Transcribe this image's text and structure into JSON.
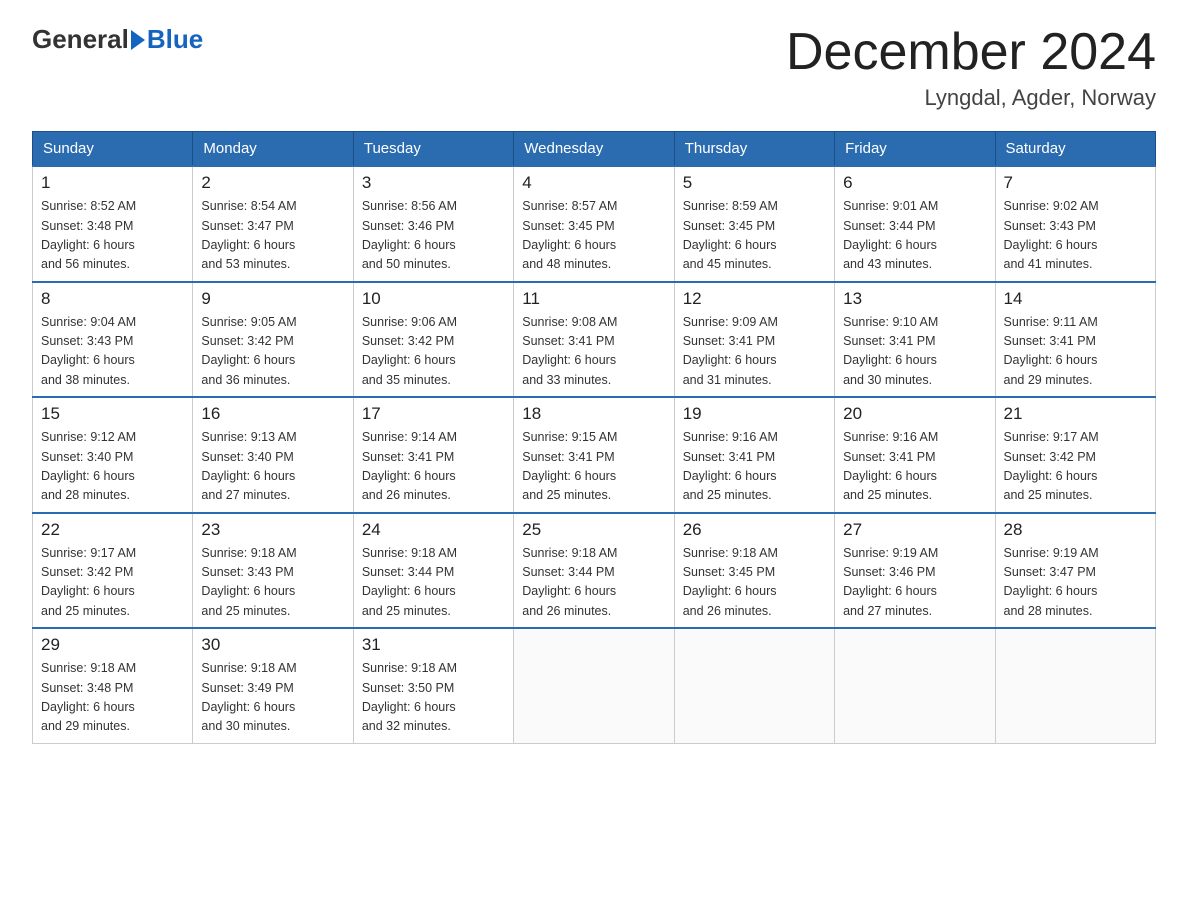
{
  "logo": {
    "general": "General",
    "blue": "Blue"
  },
  "title": "December 2024",
  "subtitle": "Lyngdal, Agder, Norway",
  "days_of_week": [
    "Sunday",
    "Monday",
    "Tuesday",
    "Wednesday",
    "Thursday",
    "Friday",
    "Saturday"
  ],
  "weeks": [
    [
      {
        "day": "1",
        "sunrise": "8:52 AM",
        "sunset": "3:48 PM",
        "daylight": "6 hours and 56 minutes."
      },
      {
        "day": "2",
        "sunrise": "8:54 AM",
        "sunset": "3:47 PM",
        "daylight": "6 hours and 53 minutes."
      },
      {
        "day": "3",
        "sunrise": "8:56 AM",
        "sunset": "3:46 PM",
        "daylight": "6 hours and 50 minutes."
      },
      {
        "day": "4",
        "sunrise": "8:57 AM",
        "sunset": "3:45 PM",
        "daylight": "6 hours and 48 minutes."
      },
      {
        "day": "5",
        "sunrise": "8:59 AM",
        "sunset": "3:45 PM",
        "daylight": "6 hours and 45 minutes."
      },
      {
        "day": "6",
        "sunrise": "9:01 AM",
        "sunset": "3:44 PM",
        "daylight": "6 hours and 43 minutes."
      },
      {
        "day": "7",
        "sunrise": "9:02 AM",
        "sunset": "3:43 PM",
        "daylight": "6 hours and 41 minutes."
      }
    ],
    [
      {
        "day": "8",
        "sunrise": "9:04 AM",
        "sunset": "3:43 PM",
        "daylight": "6 hours and 38 minutes."
      },
      {
        "day": "9",
        "sunrise": "9:05 AM",
        "sunset": "3:42 PM",
        "daylight": "6 hours and 36 minutes."
      },
      {
        "day": "10",
        "sunrise": "9:06 AM",
        "sunset": "3:42 PM",
        "daylight": "6 hours and 35 minutes."
      },
      {
        "day": "11",
        "sunrise": "9:08 AM",
        "sunset": "3:41 PM",
        "daylight": "6 hours and 33 minutes."
      },
      {
        "day": "12",
        "sunrise": "9:09 AM",
        "sunset": "3:41 PM",
        "daylight": "6 hours and 31 minutes."
      },
      {
        "day": "13",
        "sunrise": "9:10 AM",
        "sunset": "3:41 PM",
        "daylight": "6 hours and 30 minutes."
      },
      {
        "day": "14",
        "sunrise": "9:11 AM",
        "sunset": "3:41 PM",
        "daylight": "6 hours and 29 minutes."
      }
    ],
    [
      {
        "day": "15",
        "sunrise": "9:12 AM",
        "sunset": "3:40 PM",
        "daylight": "6 hours and 28 minutes."
      },
      {
        "day": "16",
        "sunrise": "9:13 AM",
        "sunset": "3:40 PM",
        "daylight": "6 hours and 27 minutes."
      },
      {
        "day": "17",
        "sunrise": "9:14 AM",
        "sunset": "3:41 PM",
        "daylight": "6 hours and 26 minutes."
      },
      {
        "day": "18",
        "sunrise": "9:15 AM",
        "sunset": "3:41 PM",
        "daylight": "6 hours and 25 minutes."
      },
      {
        "day": "19",
        "sunrise": "9:16 AM",
        "sunset": "3:41 PM",
        "daylight": "6 hours and 25 minutes."
      },
      {
        "day": "20",
        "sunrise": "9:16 AM",
        "sunset": "3:41 PM",
        "daylight": "6 hours and 25 minutes."
      },
      {
        "day": "21",
        "sunrise": "9:17 AM",
        "sunset": "3:42 PM",
        "daylight": "6 hours and 25 minutes."
      }
    ],
    [
      {
        "day": "22",
        "sunrise": "9:17 AM",
        "sunset": "3:42 PM",
        "daylight": "6 hours and 25 minutes."
      },
      {
        "day": "23",
        "sunrise": "9:18 AM",
        "sunset": "3:43 PM",
        "daylight": "6 hours and 25 minutes."
      },
      {
        "day": "24",
        "sunrise": "9:18 AM",
        "sunset": "3:44 PM",
        "daylight": "6 hours and 25 minutes."
      },
      {
        "day": "25",
        "sunrise": "9:18 AM",
        "sunset": "3:44 PM",
        "daylight": "6 hours and 26 minutes."
      },
      {
        "day": "26",
        "sunrise": "9:18 AM",
        "sunset": "3:45 PM",
        "daylight": "6 hours and 26 minutes."
      },
      {
        "day": "27",
        "sunrise": "9:19 AM",
        "sunset": "3:46 PM",
        "daylight": "6 hours and 27 minutes."
      },
      {
        "day": "28",
        "sunrise": "9:19 AM",
        "sunset": "3:47 PM",
        "daylight": "6 hours and 28 minutes."
      }
    ],
    [
      {
        "day": "29",
        "sunrise": "9:18 AM",
        "sunset": "3:48 PM",
        "daylight": "6 hours and 29 minutes."
      },
      {
        "day": "30",
        "sunrise": "9:18 AM",
        "sunset": "3:49 PM",
        "daylight": "6 hours and 30 minutes."
      },
      {
        "day": "31",
        "sunrise": "9:18 AM",
        "sunset": "3:50 PM",
        "daylight": "6 hours and 32 minutes."
      },
      null,
      null,
      null,
      null
    ]
  ],
  "labels": {
    "sunrise": "Sunrise:",
    "sunset": "Sunset:",
    "daylight": "Daylight:"
  }
}
